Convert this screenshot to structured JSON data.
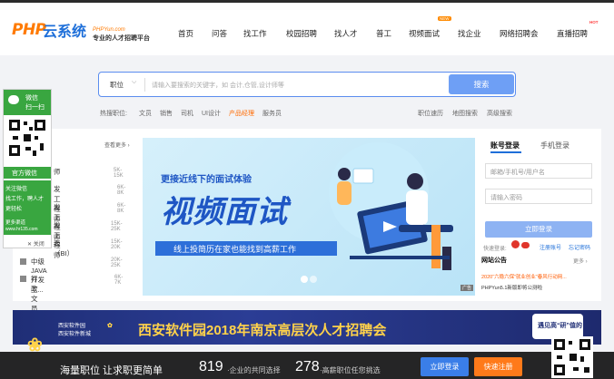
{
  "logo": {
    "brand": "PHP",
    "cn": "云系统",
    "domain": "PHPYun.com",
    "slogan": "专业的人才招聘平台"
  },
  "nav": {
    "items": [
      {
        "label": "首页"
      },
      {
        "label": "问答"
      },
      {
        "label": "找工作"
      },
      {
        "label": "校园招聘"
      },
      {
        "label": "找人才"
      },
      {
        "label": "普工"
      },
      {
        "label": "视频面试"
      },
      {
        "label": "找企业"
      },
      {
        "label": "网络招聘会"
      },
      {
        "label": "直播招聘"
      }
    ],
    "new_badge": "NEW",
    "hot_badge": "HOT"
  },
  "search": {
    "type": "职位",
    "placeholder": "请输入要搜索的关键字，如 会计,仓管,设计师等",
    "button": "搜索"
  },
  "hot": {
    "label": "热搜职位:",
    "items": [
      "文员",
      "销售",
      "司机",
      "UI设计",
      "产品经理",
      "服务员"
    ],
    "right": [
      "职位速历",
      "地图搜索",
      "高级搜索"
    ]
  },
  "categories": {
    "more": "查看更多",
    "rows": [
      {
        "name": "师",
        "salary": "5K-15K"
      },
      {
        "name": "发工程师",
        "salary": "6K-8K"
      },
      {
        "name": "发工程师",
        "salary": "6K-8K"
      },
      {
        "name": "发工程师",
        "salary": "15K-25K"
      },
      {
        "name": "表（BI）",
        "salary": "15K-20K"
      },
      {
        "name": "中级JAVA开发工...",
        "salary": "20K-25K"
      },
      {
        "name": "行政文员",
        "salary": "6K-7K"
      }
    ]
  },
  "banner": {
    "line1": "更接近线下的面试体验",
    "line2": "视频面试",
    "line3": "线上投简历在家也能找到高薪工作",
    "ad": "广告"
  },
  "login": {
    "tab_account": "账号登录",
    "tab_phone": "手机登录",
    "user_placeholder": "邮箱/手机号/用户名",
    "pass_placeholder": "请输入密码",
    "button": "立即登录",
    "quick": "快速登录:",
    "register": "注册账号",
    "forgot": "忘记密码"
  },
  "notice": {
    "title": "网站公告",
    "more": "更多",
    "items": [
      "2020“六稳六保”就业创业”春风行动网...",
      "PHPYun5.1新版即将公测啦"
    ]
  },
  "qr_side": {
    "title1": "微信",
    "title2": "扫一扫",
    "label": "官方微信",
    "t1": "关注微信",
    "t2": "找工作，聘人才",
    "t3": "更轻松",
    "more": "更多渠道",
    "site": "www.hr135.com",
    "close": "关闭"
  },
  "wide_banner": {
    "org1": "西安软件园",
    "org2": "西安软件新城",
    "title": "西安软件园2018年南京高层次人才招聘会",
    "right": "遇见高“研”值的"
  },
  "footer": {
    "t1": "海量职位 让求职更简单",
    "n1": "819",
    "u1": "·企业的共同选择",
    "n2": "278",
    "u2": "·高薪职位任您挑选",
    "btn_login": "立即登录",
    "btn_reg": "快速注册"
  },
  "colors": {
    "accent": "#1e6fd9",
    "orange": "#ff7a00",
    "search_btn": "#6e9ff5",
    "banner_dark": "#1f2e76"
  }
}
